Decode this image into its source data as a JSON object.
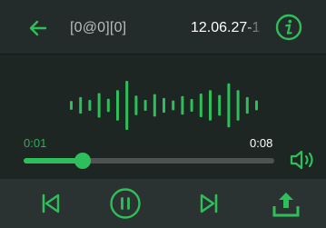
{
  "header": {
    "back_icon": "arrow-left-icon",
    "title": "[0@0][0]",
    "date": "12.06.27-1",
    "info_icon": "info-circle-icon"
  },
  "player": {
    "elapsed": "0:01",
    "total": "0:08",
    "progress_fraction": 0.235,
    "waveform_levels": [
      0.18,
      0.34,
      0.22,
      0.5,
      0.27,
      0.62,
      1.0,
      0.4,
      0.22,
      0.46,
      0.3,
      0.2,
      0.38,
      0.26,
      0.48,
      0.62,
      0.42,
      0.9,
      0.62,
      0.34,
      0.2
    ],
    "volume_icon": "speaker-icon"
  },
  "toolbar": {
    "prev_icon": "skip-previous-icon",
    "pause_icon": "pause-circle-icon",
    "next_icon": "skip-next-icon",
    "share_icon": "share-upload-icon"
  },
  "colors": {
    "accent": "#2fbf5a",
    "header_bg": "#232c2a",
    "body_bg": "#1d2623",
    "toolbar_bg": "#2a3331",
    "track": "#4d5352"
  }
}
